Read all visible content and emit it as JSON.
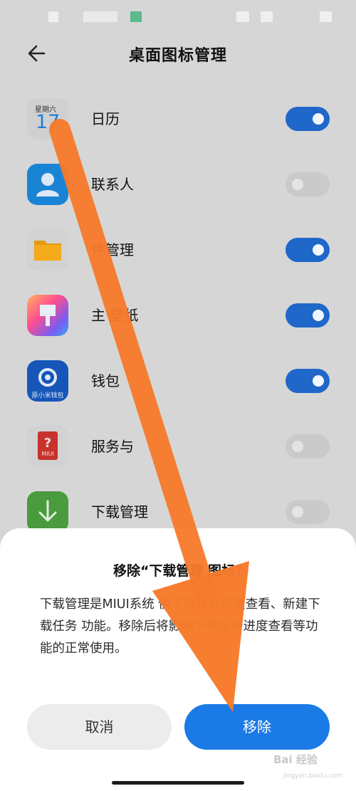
{
  "screen": {
    "title": "桌面图标管理",
    "back_icon": "arrow-left-icon"
  },
  "apps": [
    {
      "label": "日历",
      "icon": "calendar-icon",
      "enabled": true,
      "calendar_weekday": "星期六",
      "calendar_day": "17"
    },
    {
      "label": "联系人",
      "icon": "contacts-icon",
      "enabled": false
    },
    {
      "label": "件管理",
      "icon": "folder-icon",
      "enabled": true
    },
    {
      "label": "主 壁纸",
      "icon": "theme-brush-icon",
      "enabled": true
    },
    {
      "label": "钱包",
      "icon": "wallet-icon",
      "enabled": true,
      "icon_caption": "原小米钱包"
    },
    {
      "label": "服务与",
      "icon": "service-feedback-icon",
      "enabled": false,
      "icon_caption": "MIUI"
    },
    {
      "label": "下载管理",
      "icon": "download-icon",
      "enabled": false
    }
  ],
  "dialog": {
    "title": "移除“下载管理 图标?",
    "body": "下载管理是MIUI系统 供下载任务进度查看、新建下载任务 功能。移除后将影响下载任务进度查看等功能的正常使用。",
    "cancel_label": "取消",
    "remove_label": "移除"
  },
  "watermark": {
    "text": "Bai 经验",
    "sub": "jingyan.baidu.com"
  },
  "colors": {
    "toggle_on": "#1f67c9",
    "toggle_off": "#cacaca",
    "primary_button": "#1a7ae6",
    "annotation_arrow": "#f77a2a"
  }
}
